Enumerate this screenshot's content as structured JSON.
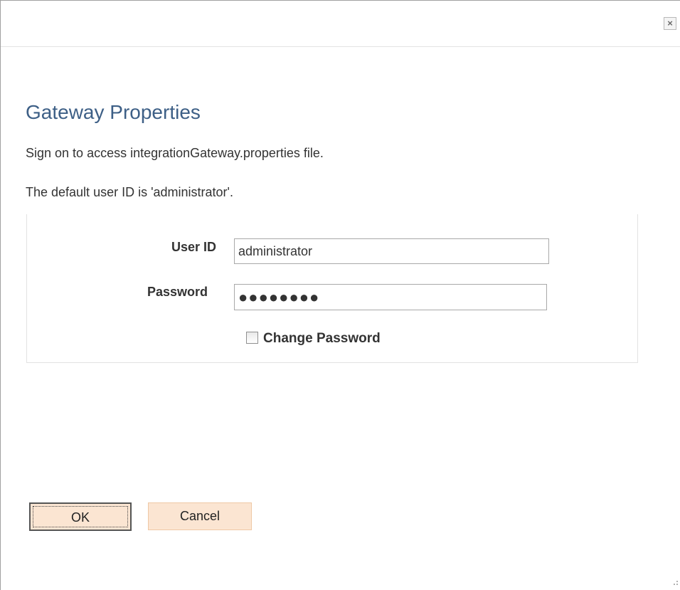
{
  "dialog": {
    "close_label": "×"
  },
  "page": {
    "title": "Gateway Properties",
    "info_line_1": "Sign on to access integrationGateway.properties file.",
    "info_line_2": "The default user ID is 'administrator'."
  },
  "form": {
    "userid_label": "User ID",
    "userid_value": "administrator",
    "password_label": "Password",
    "password_value": "●●●●●●●●",
    "change_password_label": "Change Password",
    "change_password_checked": false
  },
  "buttons": {
    "ok_label": "OK",
    "cancel_label": "Cancel"
  },
  "icons": {
    "close": "close-icon",
    "resize": "resize-grip-icon"
  },
  "colors": {
    "title": "#3d5f86",
    "button_bg": "#fbe5d2",
    "cancel_border": "#efc8a5"
  }
}
